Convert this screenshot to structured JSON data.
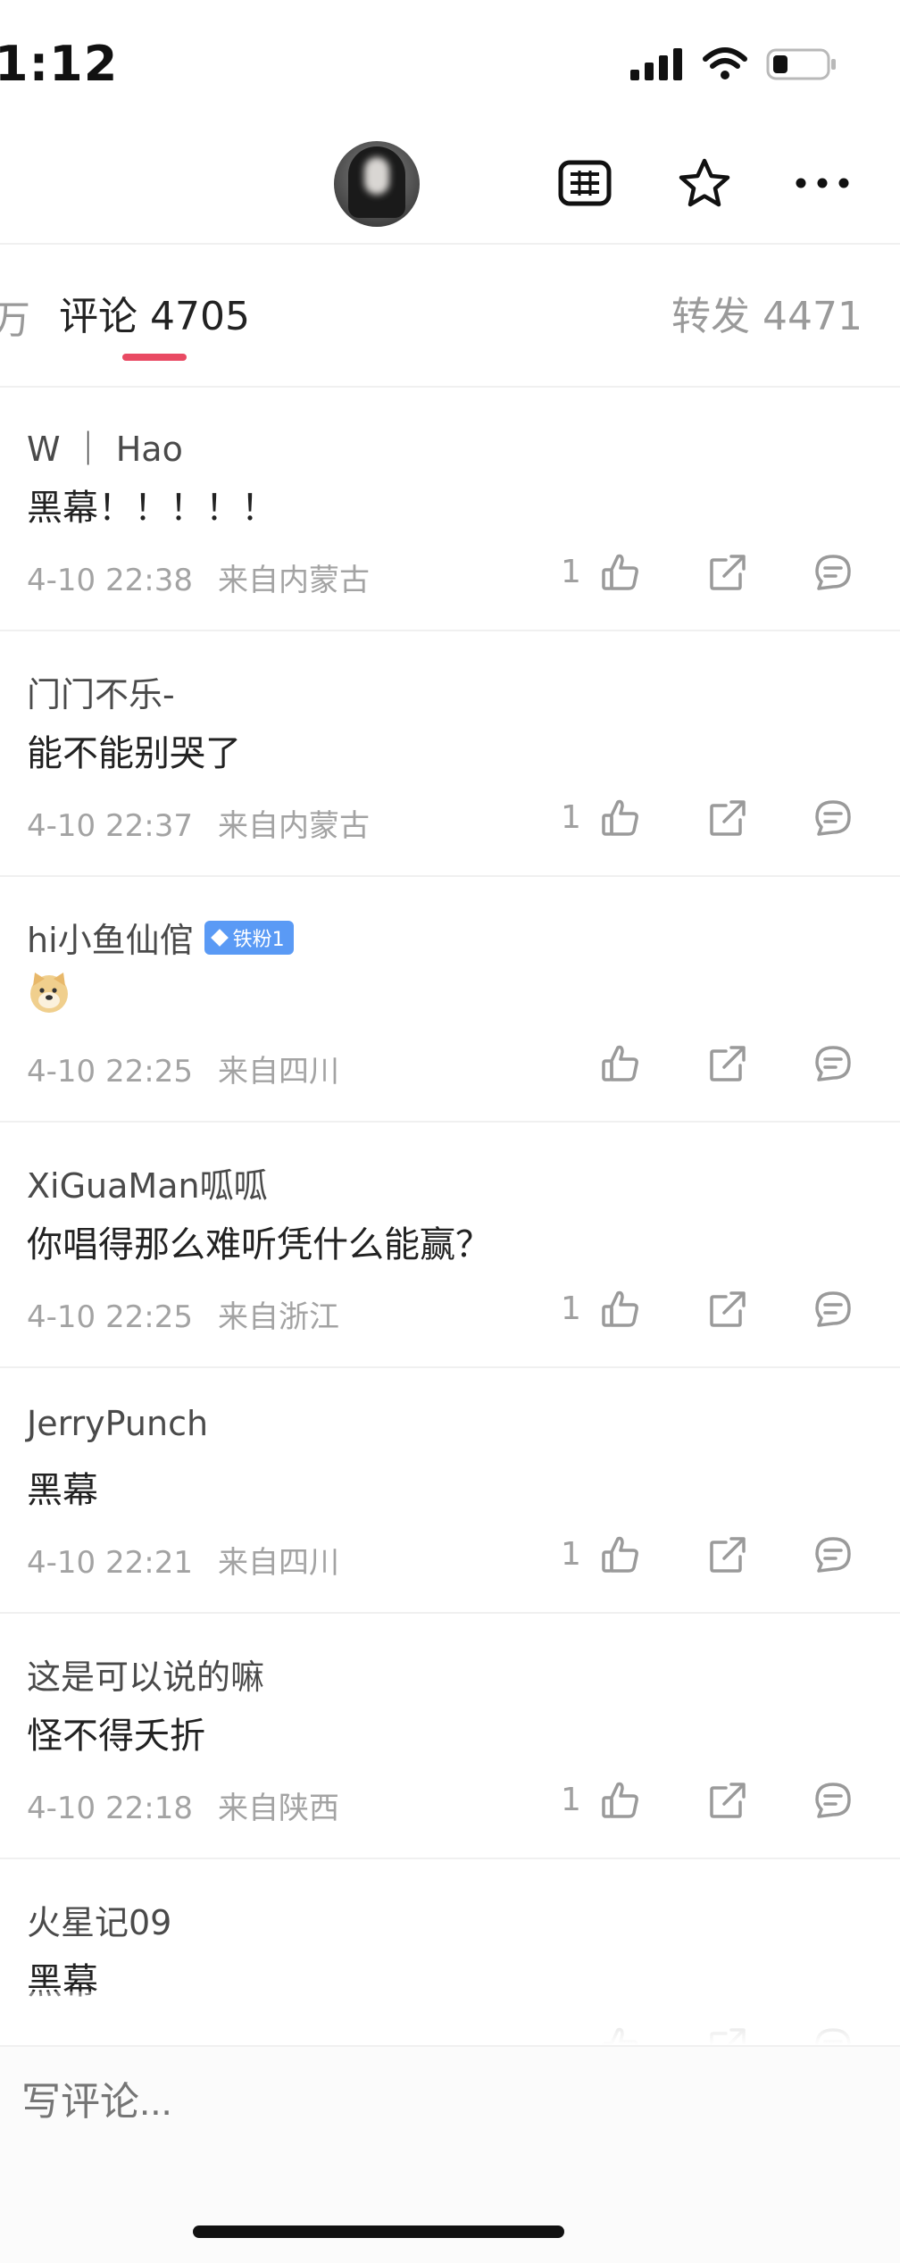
{
  "status_bar": {
    "time": "1:12"
  },
  "header": {
    "icons": [
      "grid-list-icon",
      "star-icon",
      "more-icon"
    ]
  },
  "tabs": {
    "prev_fragment": "万",
    "comments_label": "评论 4705",
    "forwards_label": "转发 4471"
  },
  "comments": [
    {
      "user": "W ｜ Hao",
      "text": "黑幕！！！！！",
      "time": "4-10 22:38",
      "location": "来自内蒙古",
      "likes": "1"
    },
    {
      "user": "门门不乐-",
      "text": "能不能别哭了",
      "time": "4-10 22:37",
      "location": "来自内蒙古",
      "likes": "1"
    },
    {
      "user": "hi小鱼仙倌",
      "badge": "铁粉1",
      "text": "",
      "emoji": "doge-emoji",
      "time": "4-10 22:25",
      "location": "来自四川",
      "likes": ""
    },
    {
      "user": "XiGuaMan呱呱",
      "text": "你唱得那么难听凭什么能赢？",
      "time": "4-10 22:25",
      "location": "来自浙江",
      "likes": "1"
    },
    {
      "user": "JerryPunch",
      "text": "黑幕",
      "time": "4-10 22:21",
      "location": "来自四川",
      "likes": "1"
    },
    {
      "user": "这是可以说的嘛",
      "text": "怪不得夭折",
      "time": "4-10 22:18",
      "location": "来自陕西",
      "likes": "1"
    },
    {
      "user": "火星记09",
      "text": "黑幕",
      "time": "",
      "location": "",
      "likes": ""
    }
  ],
  "bottom_bar": {
    "placeholder": "写评论..."
  },
  "colors": {
    "accent": "#e94a63",
    "badge": "#5a9af5",
    "meta_text": "#a3a3a3"
  }
}
